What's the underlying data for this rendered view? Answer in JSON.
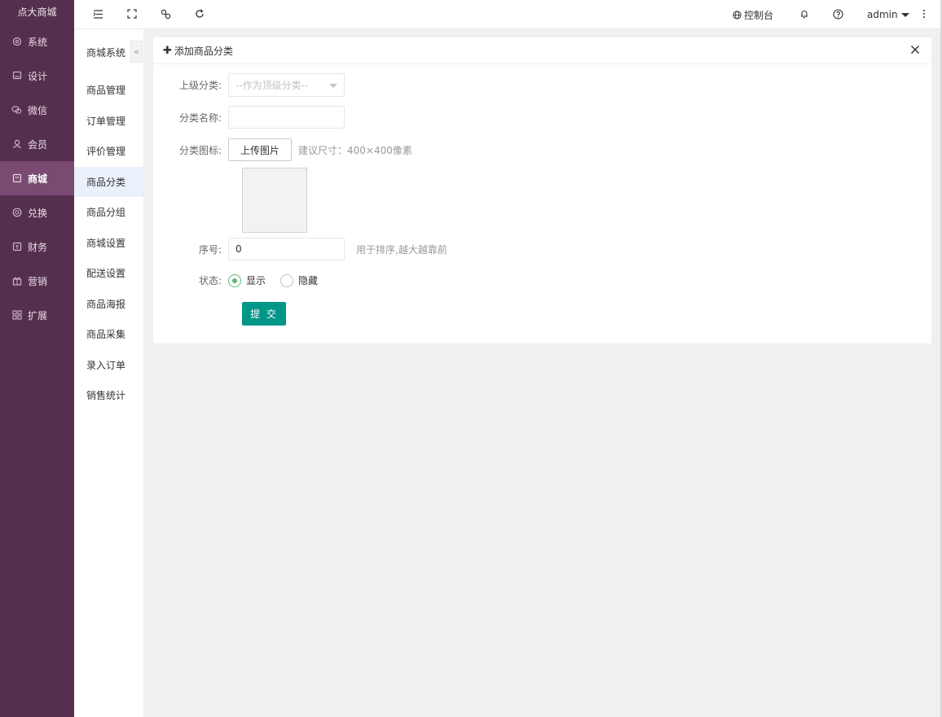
{
  "brand": "点大商城",
  "main_nav": [
    {
      "label": "系统",
      "icon": "gear-icon"
    },
    {
      "label": "设计",
      "icon": "monitor-icon"
    },
    {
      "label": "微信",
      "icon": "wechat-icon"
    },
    {
      "label": "会员",
      "icon": "user-icon"
    },
    {
      "label": "商城",
      "icon": "shop-bag-icon",
      "active": true
    },
    {
      "label": "兑换",
      "icon": "exchange-icon"
    },
    {
      "label": "财务",
      "icon": "finance-icon"
    },
    {
      "label": "营销",
      "icon": "gift-icon"
    },
    {
      "label": "扩展",
      "icon": "grid-icon"
    }
  ],
  "sub_nav": {
    "title": "商城系统",
    "collapse_glyph": "«",
    "items": [
      {
        "label": "商品管理"
      },
      {
        "label": "订单管理"
      },
      {
        "label": "评价管理"
      },
      {
        "label": "商品分类",
        "active": true
      },
      {
        "label": "商品分组"
      },
      {
        "label": "商城设置"
      },
      {
        "label": "配送设置"
      },
      {
        "label": "商品海报"
      },
      {
        "label": "商品采集"
      },
      {
        "label": "录入订单"
      },
      {
        "label": "销售统计"
      }
    ]
  },
  "topbar": {
    "icons": [
      "menu-fold-icon",
      "fullscreen-icon",
      "link-icon",
      "refresh-icon"
    ],
    "console_label": "控制台",
    "user": "admin"
  },
  "form": {
    "title": "添加商品分类",
    "parent_label": "上级分类:",
    "parent_placeholder": "--作为顶级分类--",
    "name_label": "分类名称:",
    "name_value": "",
    "icon_label": "分类图标:",
    "upload_button": "上传图片",
    "upload_hint": "建议尺寸：400×400像素",
    "order_label": "序号:",
    "order_value": "0",
    "order_hint": "用于排序,越大越靠前",
    "status_label": "状态:",
    "status_options": [
      "显示",
      "隐藏"
    ],
    "status_selected": "显示",
    "submit": "提 交"
  },
  "colors": {
    "sidebar_bg": "#55304e",
    "sidebar_active": "#7a4a72",
    "submit_bg": "#009688",
    "radio_on": "#5fb878"
  }
}
